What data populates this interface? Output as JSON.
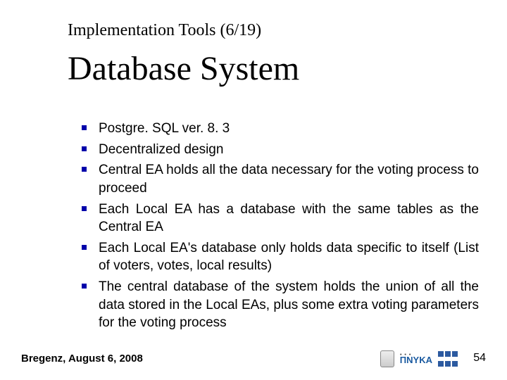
{
  "supertitle": "Implementation Tools (6/19)",
  "title": "Database System",
  "bullets": [
    "Postgre. SQL ver. 8. 3",
    "Decentralized design",
    "Central EA holds all the data necessary for the voting process to proceed",
    "Each Local EA has a database with the same tables as the Central EA",
    "Each Local EA's database only holds data specific to itself (List of voters, votes, local results)",
    "The central database of the system holds the union of all the data stored in the Local EAs, plus some extra voting parameters for the voting process"
  ],
  "footer_left": "Bregenz, August 6, 2008",
  "page_number": "54",
  "logos": {
    "pnyka_label": "ΠΝΥΚΑ"
  }
}
